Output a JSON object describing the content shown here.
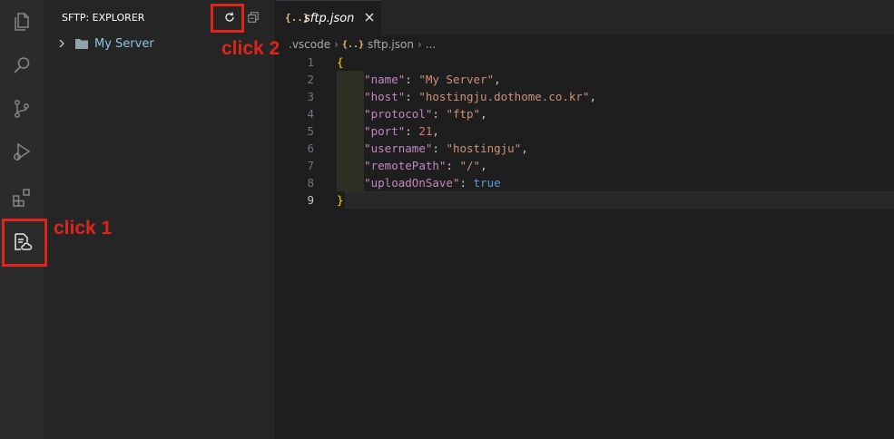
{
  "sidebar": {
    "title": "SFTP: EXPLORER",
    "tree": [
      {
        "label": "My Server",
        "icon": "folder-icon",
        "expanded": false
      }
    ]
  },
  "editor": {
    "tab": {
      "icon_text": "{..}",
      "label": "sftp.json",
      "icon": "json-file-icon"
    },
    "breadcrumb": {
      "folder": ".vscode",
      "file_icon_text": "{..}",
      "file": "sftp.json",
      "rest": "..."
    },
    "lines": [
      {
        "n": "1",
        "tokens": [
          {
            "t": "{",
            "c": "tk-brace"
          }
        ]
      },
      {
        "n": "2",
        "tokens": [
          {
            "t": "    ",
            "c": ""
          },
          {
            "t": "\"name\"",
            "c": "tk-key"
          },
          {
            "t": ": ",
            "c": "tk-punct"
          },
          {
            "t": "\"My Server\"",
            "c": "tk-str"
          },
          {
            "t": ",",
            "c": "tk-punct"
          }
        ]
      },
      {
        "n": "3",
        "tokens": [
          {
            "t": "    ",
            "c": ""
          },
          {
            "t": "\"host\"",
            "c": "tk-key"
          },
          {
            "t": ": ",
            "c": "tk-punct"
          },
          {
            "t": "\"hostingju.dothome.co.kr\"",
            "c": "tk-str"
          },
          {
            "t": ",",
            "c": "tk-punct"
          }
        ]
      },
      {
        "n": "4",
        "tokens": [
          {
            "t": "    ",
            "c": ""
          },
          {
            "t": "\"protocol\"",
            "c": "tk-key"
          },
          {
            "t": ": ",
            "c": "tk-punct"
          },
          {
            "t": "\"ftp\"",
            "c": "tk-str"
          },
          {
            "t": ",",
            "c": "tk-punct"
          }
        ]
      },
      {
        "n": "5",
        "tokens": [
          {
            "t": "    ",
            "c": ""
          },
          {
            "t": "\"port\"",
            "c": "tk-key"
          },
          {
            "t": ": ",
            "c": "tk-punct"
          },
          {
            "t": "21",
            "c": "tk-num"
          },
          {
            "t": ",",
            "c": "tk-punct"
          }
        ]
      },
      {
        "n": "6",
        "tokens": [
          {
            "t": "    ",
            "c": ""
          },
          {
            "t": "\"username\"",
            "c": "tk-key"
          },
          {
            "t": ": ",
            "c": "tk-punct"
          },
          {
            "t": "\"hostingju\"",
            "c": "tk-str"
          },
          {
            "t": ",",
            "c": "tk-punct"
          }
        ]
      },
      {
        "n": "7",
        "tokens": [
          {
            "t": "    ",
            "c": ""
          },
          {
            "t": "\"remotePath\"",
            "c": "tk-key"
          },
          {
            "t": ": ",
            "c": "tk-punct"
          },
          {
            "t": "\"/\"",
            "c": "tk-str"
          },
          {
            "t": ",",
            "c": "tk-punct"
          }
        ]
      },
      {
        "n": "8",
        "tokens": [
          {
            "t": "    ",
            "c": ""
          },
          {
            "t": "\"uploadOnSave\"",
            "c": "tk-key"
          },
          {
            "t": ": ",
            "c": "tk-punct"
          },
          {
            "t": "true",
            "c": "tk-bool"
          }
        ]
      },
      {
        "n": "9",
        "tokens": [
          {
            "t": "}",
            "c": "tk-brace"
          }
        ],
        "current": true
      }
    ]
  },
  "annotations": {
    "click1": "click 1",
    "click2": "click 2",
    "color": "#e0241c"
  },
  "activity_bar": [
    "explorer-icon",
    "search-icon",
    "source-control-icon",
    "run-debug-icon",
    "extensions-icon",
    "sftp-icon"
  ]
}
